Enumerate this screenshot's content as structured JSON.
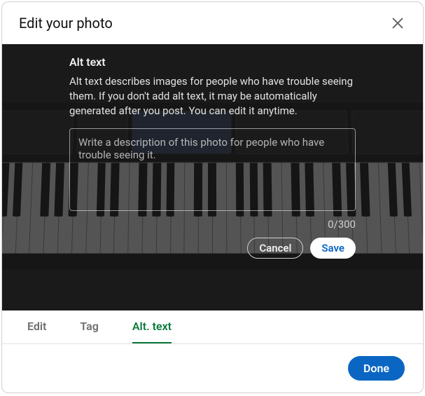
{
  "header": {
    "title": "Edit your photo"
  },
  "overlay": {
    "title": "Alt text",
    "description": "Alt text describes images for people who have trouble seeing them. If you don't add alt text, it may be automatically generated after you post. You can edit it anytime.",
    "placeholder": "Write a description of this photo for people who have trouble seeing it.",
    "value": "",
    "char_count": "0/300",
    "cancel_label": "Cancel",
    "save_label": "Save"
  },
  "tabs": {
    "edit": "Edit",
    "tag": "Tag",
    "alt": "Alt. text",
    "active": "alt"
  },
  "footer": {
    "done_label": "Done"
  },
  "icons": {
    "close": "close-icon"
  }
}
